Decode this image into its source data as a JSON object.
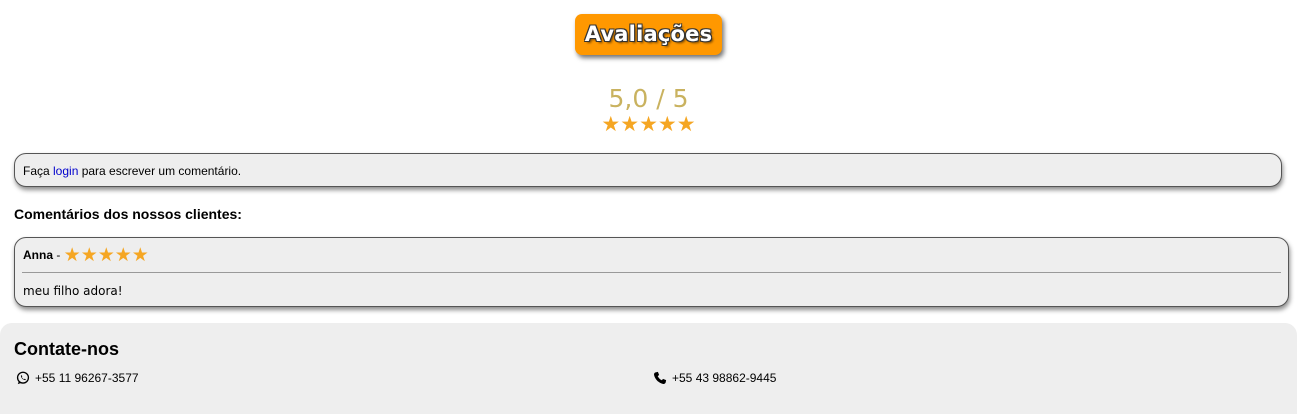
{
  "reviews": {
    "title": "Avaliações",
    "score": "5,0 / 5",
    "score_stars": "★★★★★",
    "rating_value": 5,
    "rating_max": 5
  },
  "login_prompt": {
    "prefix": "Faça ",
    "link": "login",
    "suffix": " para escrever um comentário."
  },
  "comments": {
    "heading": "Comentários dos nossos clientes:",
    "items": [
      {
        "author": "Anna",
        "separator": " - ",
        "stars": "★★★★★",
        "rating": 5,
        "text": "meu filho adora!"
      }
    ]
  },
  "footer": {
    "title": "Contate-nos",
    "whatsapp": "+55 11 96267-3577",
    "phone": "+55 43 98862-9445"
  },
  "colors": {
    "accent": "#ff9800",
    "star": "#f5a623",
    "score": "#c9b25f",
    "link": "#0000cc",
    "panel": "#eeeeee"
  },
  "icons": {
    "whatsapp": "whatsapp-icon",
    "phone": "phone-icon",
    "star": "star-icon"
  }
}
